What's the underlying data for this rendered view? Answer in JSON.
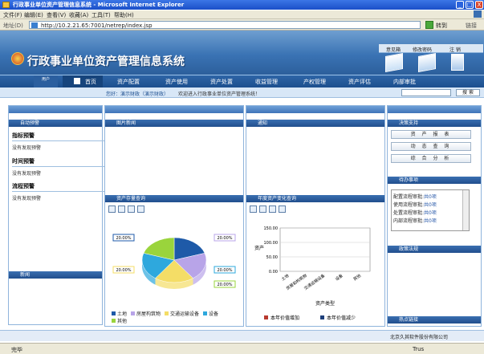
{
  "window": {
    "title": "行政事业单位资产管理信息系统 - Microsoft Internet Explorer",
    "min": "_",
    "max": "□",
    "close": "X"
  },
  "menu": [
    "文件(F)",
    "编辑(E)",
    "查看(V)",
    "收藏(A)",
    "工具(T)",
    "帮助(H)"
  ],
  "address": {
    "label": "地址(D)",
    "value": "http://10.2.21.65:7001/netrep/index.jsp",
    "go": "转到",
    "links": "链接"
  },
  "header": {
    "title": "行政事业单位资产管理信息系统",
    "links": [
      "意见箱",
      "修改密码",
      "注 销"
    ]
  },
  "nav": {
    "user": "用户",
    "items": [
      "首页",
      "资产配置",
      "资产使用",
      "资产处置",
      "收益管理",
      "产权管理",
      "资产评估",
      "内部审批"
    ]
  },
  "sub": {
    "user_text": "您好：演示财政（演示财政）",
    "welcome": "欢迎进入行政事业单位资产管理系统！",
    "search_btn": "搜 索"
  },
  "left": {
    "title": "自动预警",
    "boxes": [
      {
        "h": "指标预警",
        "i": "没有发现预警"
      },
      {
        "h": "时间预警",
        "i": "没有发现预警"
      },
      {
        "h": "流程预警",
        "i": "没有发现预警"
      }
    ],
    "news": "新闻"
  },
  "col2": {
    "top": "图片新闻",
    "chart_title": "资产存量查询"
  },
  "col3": {
    "top": "通知",
    "chart_title": "年度资产变化查询"
  },
  "right": {
    "qs_title": "决策支持",
    "qs": [
      "资 产 报 表",
      "动 态 查 询",
      "综 合 分 析"
    ],
    "todo_title": "待办事项",
    "todo": [
      {
        "t": "配置流程审批:",
        "n": "共0项"
      },
      {
        "t": "使用流程审批:",
        "n": "共0项"
      },
      {
        "t": "处置流程审批:",
        "n": "共0项"
      },
      {
        "t": "内部流程审批:",
        "n": "共0项"
      }
    ],
    "policy": "政策法规",
    "hot": "热点链接"
  },
  "footer": {
    "company": "北京久其软件股份有限公司",
    "status": "完毕",
    "trust": "Trus"
  },
  "chart_data": [
    {
      "type": "pie",
      "labels": [
        "土地",
        "房屋构筑物",
        "交通运输设备",
        "设备",
        "其他"
      ],
      "values": [
        20,
        20,
        20,
        20,
        20
      ],
      "slice_labels": [
        "20.00%",
        "20.00%",
        "20.00%",
        "20.00%",
        "20.00%"
      ],
      "colors": [
        "#1e5aa8",
        "#b8a4e8",
        "#f4dd66",
        "#2ea8dd",
        "#9ad43c"
      ],
      "legend": [
        "土地",
        "房屋构筑物",
        "交通运输设备",
        "设备",
        "其他"
      ]
    },
    {
      "type": "bar",
      "categories": [
        "土地",
        "房屋和构筑物",
        "交通运输设备",
        "设备",
        "其他"
      ],
      "ylim": [
        0,
        150
      ],
      "yticks": [
        "150.00",
        "100.00",
        "50.00",
        "0.00"
      ],
      "series": [
        {
          "name": "本年价值增加",
          "values": [
            0,
            0,
            0,
            0,
            0
          ],
          "color": "#b83a2f"
        },
        {
          "name": "本年价值减少",
          "values": [
            0,
            0,
            0,
            0,
            0
          ],
          "color": "#1e3f7a"
        }
      ],
      "xlabel": "资产类型",
      "ylabel": "资产",
      "legend_placement": "bottom"
    }
  ],
  "colors": {
    "header_blue": "#3a73b4",
    "nav_blue": "#1c4f8e",
    "panel_border": "#8fb4dc"
  }
}
